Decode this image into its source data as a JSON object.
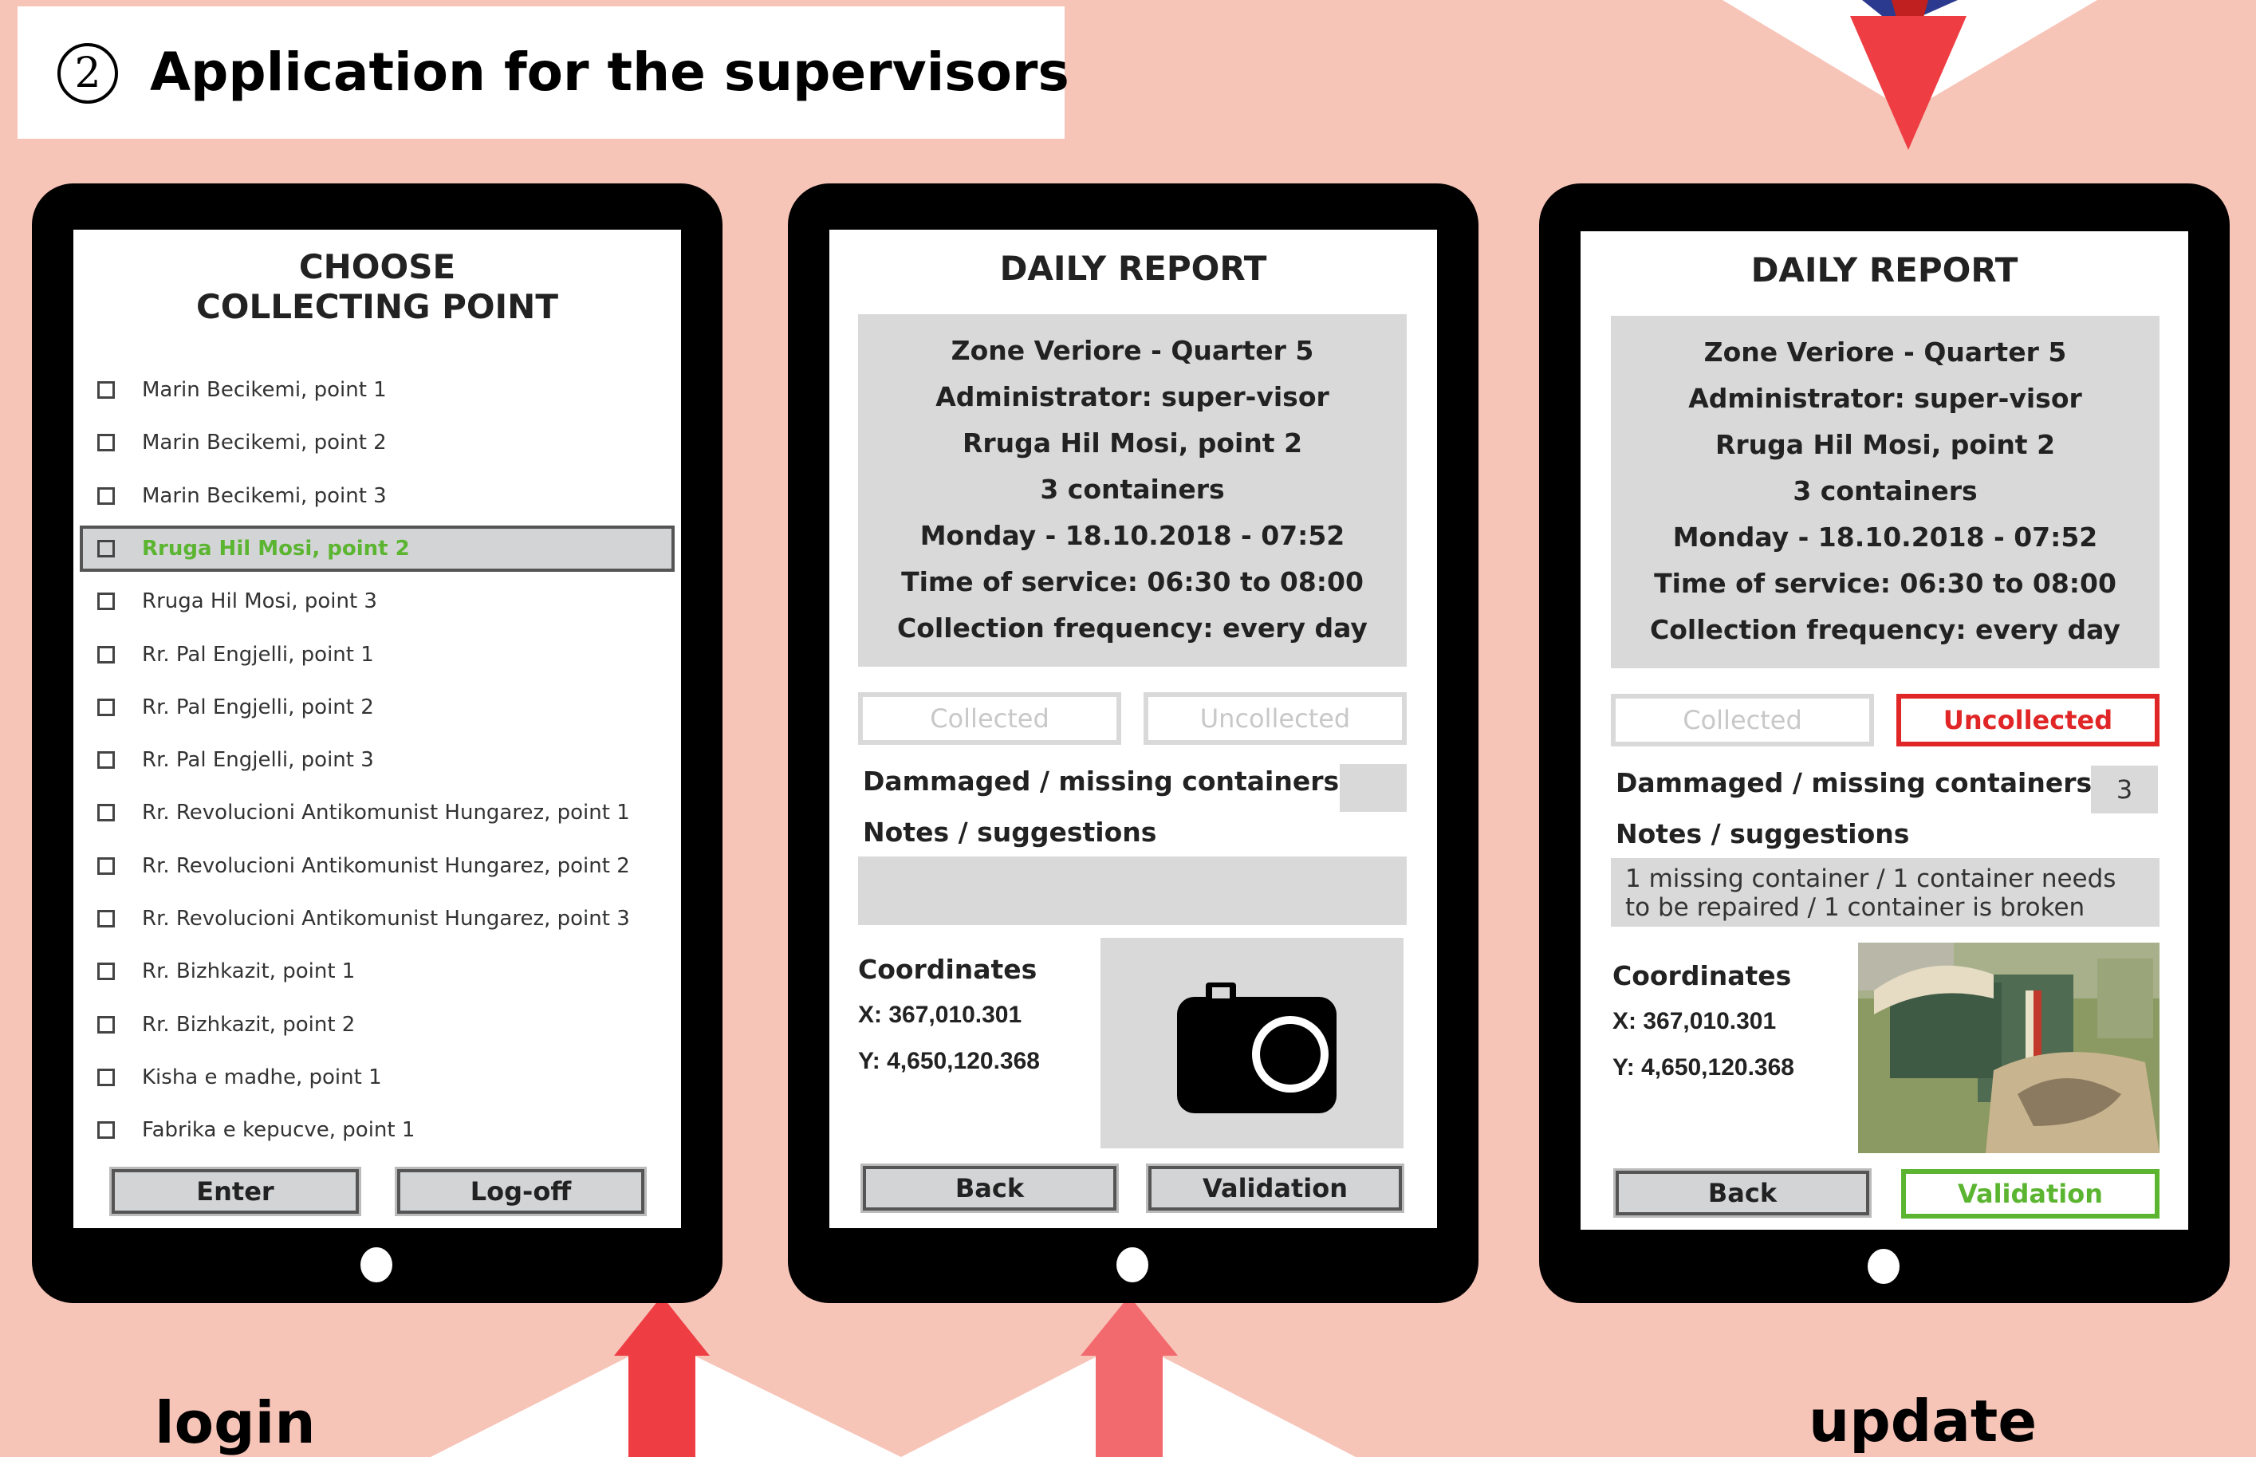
{
  "header": {
    "step": "2",
    "title": "Application for the supervisors"
  },
  "screen1": {
    "title_line1": "CHOOSE",
    "title_line2": "COLLECTING POINT",
    "points": [
      "Marin Becikemi, point 1",
      "Marin Becikemi, point 2",
      "Marin Becikemi, point 3",
      "Rruga Hil Mosi, point 2",
      "Rruga Hil Mosi, point 3",
      "Rr. Pal Engjelli, point 1",
      "Rr. Pal Engjelli, point 2",
      "Rr. Pal Engjelli, point 3",
      "Rr. Revolucioni Antikomunist Hungarez, point 1",
      "Rr. Revolucioni Antikomunist Hungarez, point 2",
      "Rr. Revolucioni Antikomunist Hungarez, point 3",
      "Rr. Bizhkazit, point 1",
      "Rr. Bizhkazit, point 2",
      "Kisha e madhe, point 1",
      "Fabrika e kepucve, point 1"
    ],
    "selected_index": 3,
    "enter_label": "Enter",
    "logoff_label": "Log-off"
  },
  "screen2": {
    "title": "DAILY REPORT",
    "info": [
      "Zone Veriore - Quarter 5",
      "Administrator: super-visor",
      "Rruga Hil Mosi, point 2",
      "3 containers",
      "Monday - 18.10.2018 - 07:52",
      "Time of service: 06:30 to 08:00",
      "Collection frequency: every day"
    ],
    "collected_label": "Collected",
    "uncollected_label": "Uncollected",
    "damaged_label": "Dammaged / missing containers",
    "damaged_value": "",
    "notes_label": "Notes / suggestions",
    "notes_value": "",
    "coordinates_label": "Coordinates",
    "x": "X: 367,010.301",
    "y": "Y: 4,650,120.368",
    "photo_icon": "camera-icon",
    "back_label": "Back",
    "validation_label": "Validation"
  },
  "screen3": {
    "title": "DAILY REPORT",
    "info": [
      "Zone Veriore - Quarter 5",
      "Administrator: super-visor",
      "Rruga Hil Mosi, point 2",
      "3 containers",
      "Monday - 18.10.2018 - 07:52",
      "Time of service: 06:30 to 08:00",
      "Collection frequency: every day"
    ],
    "collected_label": "Collected",
    "uncollected_label": "Uncollected",
    "damaged_label": "Dammaged / missing containers",
    "damaged_value": "3",
    "notes_label": "Notes / suggestions",
    "notes_line1": "1 missing container / 1 container needs",
    "notes_line2": "to be repaired / 1 container is broken",
    "coordinates_label": "Coordinates",
    "x": "X: 367,010.301",
    "y": "Y: 4,650,120.368",
    "back_label": "Back",
    "validation_label": "Validation"
  },
  "bottom": {
    "left_label": "login",
    "right_label": "update"
  },
  "colors": {
    "background": "#f7c4b8",
    "green": "#5bb531",
    "red": "#e02626",
    "arrow": "#ee3e44"
  }
}
